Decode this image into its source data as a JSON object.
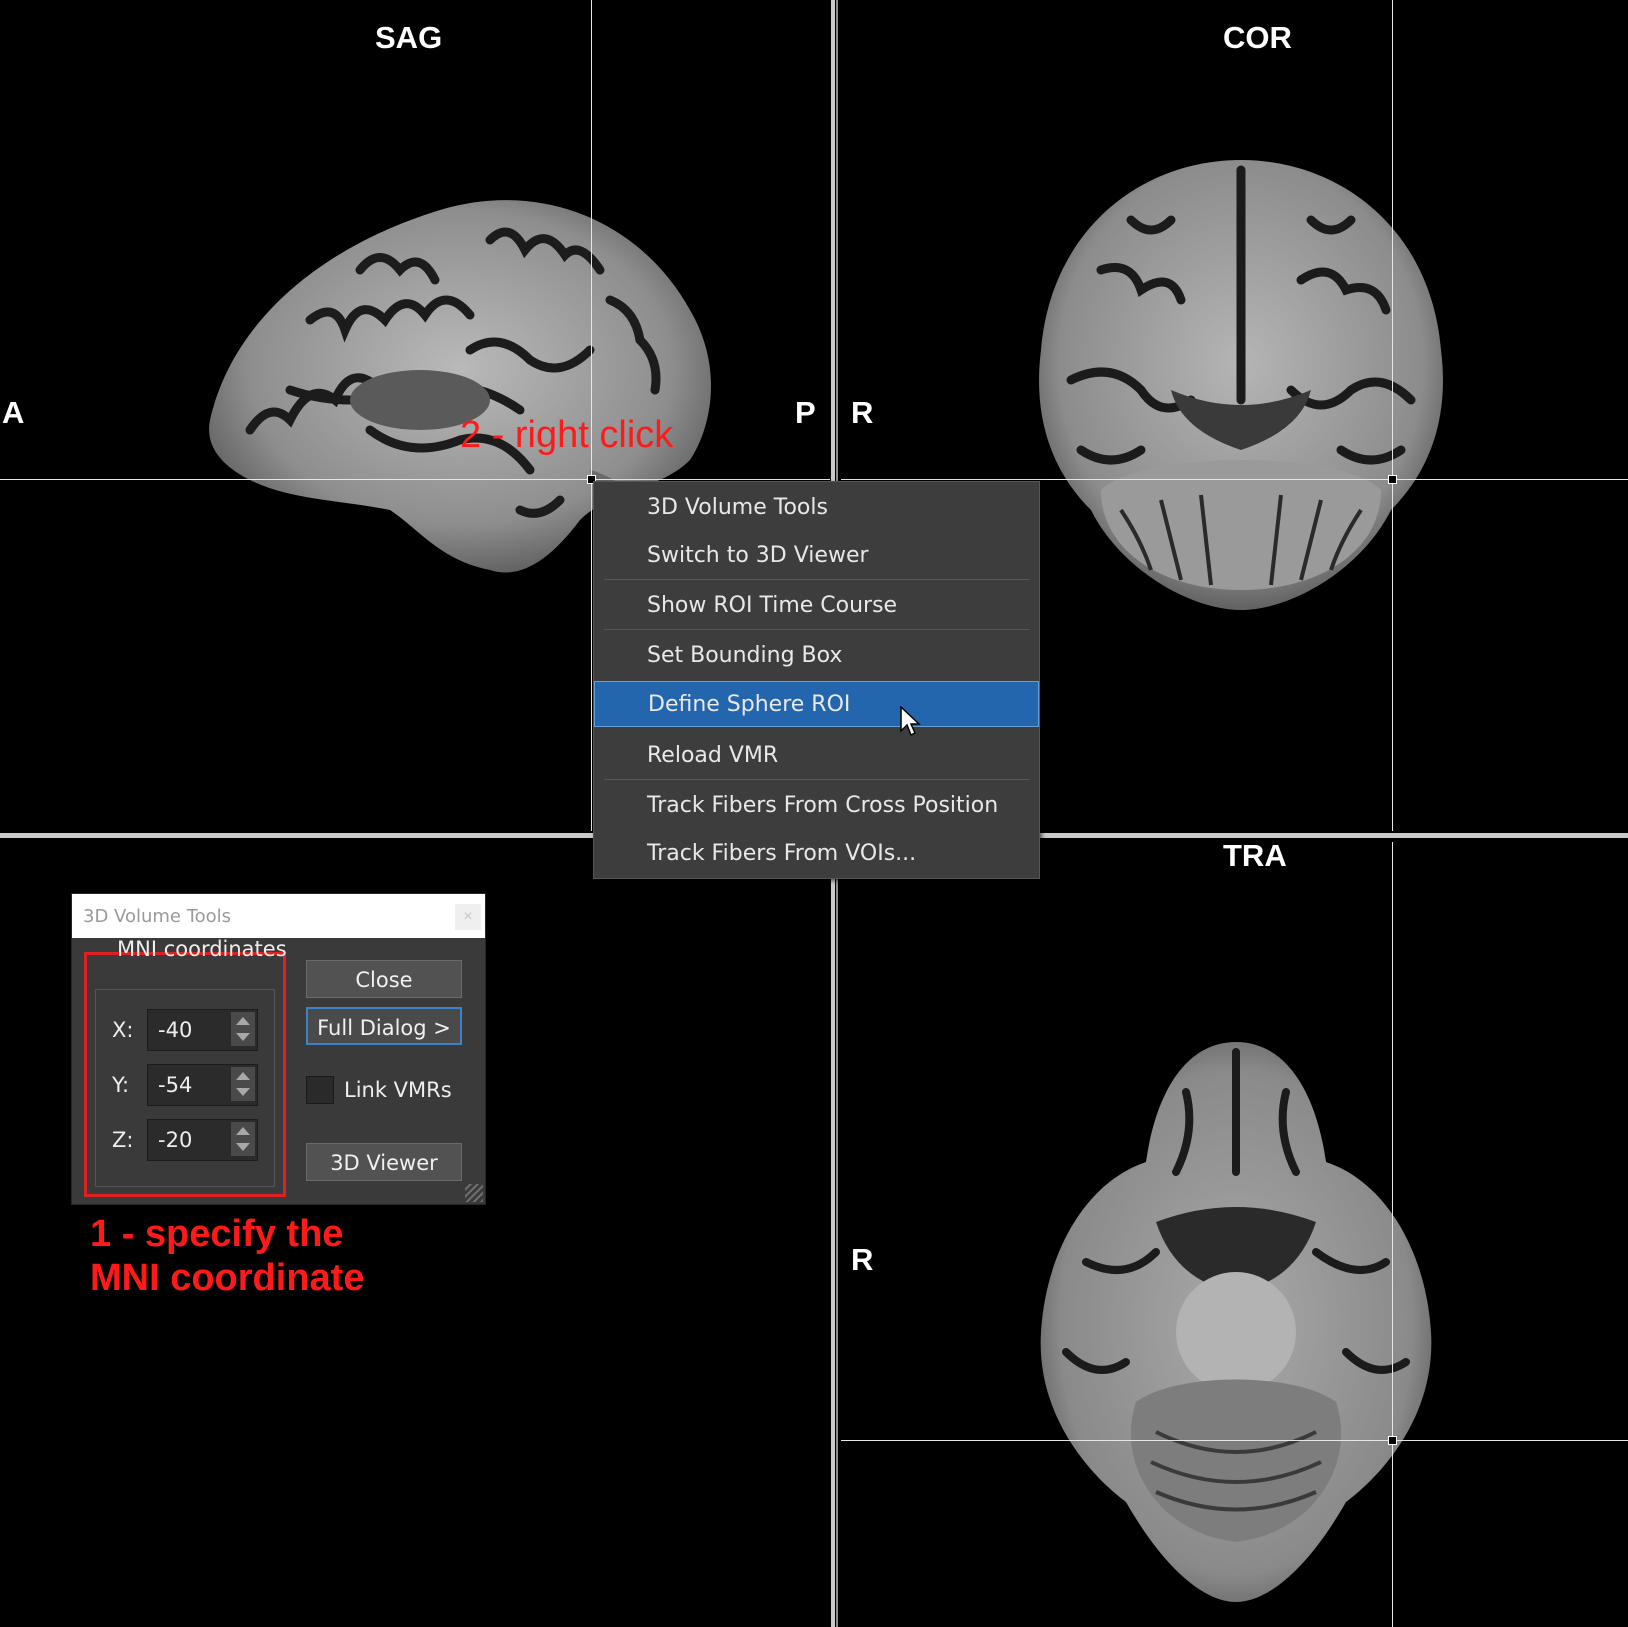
{
  "views": {
    "sag": {
      "title": "SAG",
      "left_orient": "A",
      "right_orient": "P"
    },
    "cor": {
      "title": "COR",
      "left_orient": "R"
    },
    "tra": {
      "title": "TRA",
      "left_orient": "R"
    }
  },
  "context_menu": {
    "items": [
      {
        "label": "3D Volume Tools"
      },
      {
        "label": "Switch to 3D Viewer"
      },
      {
        "label": "Show ROI Time Course"
      },
      {
        "label": "Set Bounding Box"
      },
      {
        "label": "Define Sphere ROI",
        "highlighted": true
      },
      {
        "label": "Reload VMR"
      },
      {
        "label": "Track Fibers From Cross Position"
      },
      {
        "label": "Track Fibers From VOIs..."
      }
    ]
  },
  "dialog": {
    "title": "3D Volume Tools",
    "close_x": "×",
    "group_label": "MNI coordinates",
    "x_label": "X:",
    "x_value": "-40",
    "y_label": "Y:",
    "y_value": "-54",
    "z_label": "Z:",
    "z_value": "-20",
    "close_button": "Close",
    "full_dialog_button": "Full Dialog >",
    "link_vmrs_label": "Link VMRs",
    "link_vmrs_checked": false,
    "viewer_button": "3D Viewer"
  },
  "annotations": {
    "step2": "2 - right click",
    "step1_line1": "1 - specify the",
    "step1_line2": "MNI coordinate"
  },
  "colors": {
    "annotation": "#ff1a1a",
    "menu_highlight": "#2366ad",
    "menu_bg": "#3d3d3d",
    "dialog_bg": "#3a3a3a"
  }
}
